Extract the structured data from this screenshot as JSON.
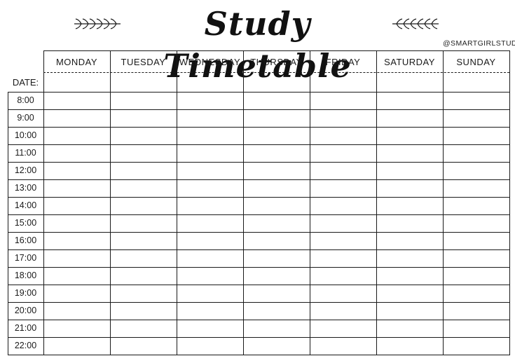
{
  "header": {
    "title": "Study Timetable",
    "handle": "@SMARTGIRLSTUDY",
    "decoration_icon": "laurel-sprig-icon"
  },
  "timetable": {
    "date_label": "DATE:",
    "days": [
      "MONDAY",
      "TUESDAY",
      "WEDNESDAY",
      "THURSDAY",
      "FRIDAY",
      "SATURDAY",
      "SUNDAY"
    ],
    "times": [
      "8:00",
      "9:00",
      "10:00",
      "11:00",
      "12:00",
      "13:00",
      "14:00",
      "15:00",
      "16:00",
      "17:00",
      "18:00",
      "19:00",
      "20:00",
      "21:00",
      "22:00"
    ]
  },
  "colors": {
    "ink": "#1a1a1a",
    "paper": "#ffffff"
  }
}
